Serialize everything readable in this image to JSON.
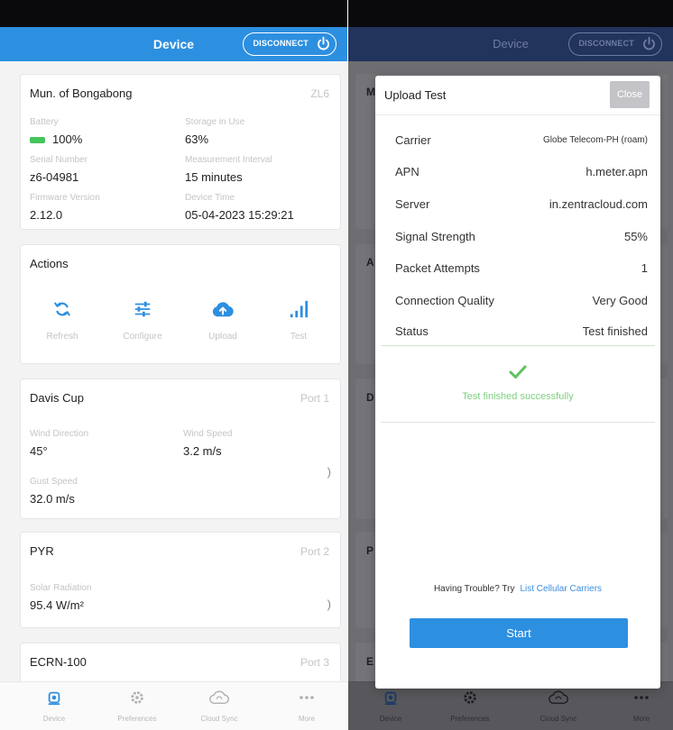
{
  "app": {
    "header_title": "Device",
    "disconnect_label": "DISCONNECT",
    "accent_color": "#2d8fe0"
  },
  "device": {
    "name": "Mun. of Bongabong",
    "model": "ZL6",
    "fields": [
      {
        "label": "Battery",
        "value": "100%"
      },
      {
        "label": "Storage in Use",
        "value": "63%"
      },
      {
        "label": "Serial Number",
        "value": "z6-04981"
      },
      {
        "label": "Measurement Interval",
        "value": "15 minutes"
      },
      {
        "label": "Firmware Version",
        "value": "2.12.0"
      },
      {
        "label": "Device Time",
        "value": "05-04-2023 15:29:21"
      }
    ]
  },
  "actions": {
    "title": "Actions",
    "items": [
      {
        "label": "Refresh",
        "icon": "refresh-icon"
      },
      {
        "label": "Configure",
        "icon": "sliders-icon"
      },
      {
        "label": "Upload",
        "icon": "cloud-upload-icon"
      },
      {
        "label": "Test",
        "icon": "signal-bars-icon"
      }
    ]
  },
  "sensors": [
    {
      "name": "Davis Cup",
      "port": "Port 1",
      "fields": [
        {
          "label": "Wind Direction",
          "value": "45°"
        },
        {
          "label": "Wind Speed",
          "value": "3.2 m/s"
        },
        {
          "label": "Gust Speed",
          "value": "32.0 m/s"
        }
      ]
    },
    {
      "name": "PYR",
      "port": "Port 2",
      "fields": [
        {
          "label": "Solar Radiation",
          "value": "95.4 W/m²"
        }
      ]
    },
    {
      "name": "ECRN-100",
      "port": "Port 3",
      "fields": []
    }
  ],
  "tabs": [
    {
      "label": "Device",
      "icon": "device-icon"
    },
    {
      "label": "Preferences",
      "icon": "gear-icon"
    },
    {
      "label": "Cloud Sync",
      "icon": "cloud-sync-icon"
    },
    {
      "label": "More",
      "icon": "more-icon"
    }
  ],
  "background": {
    "card_letters": [
      "M",
      "A",
      "D",
      "P",
      "E"
    ]
  },
  "upload_test": {
    "title": "Upload Test",
    "close_label": "Close",
    "rows": [
      {
        "label": "Carrier",
        "value": "Globe Telecom-PH (roam)"
      },
      {
        "label": "APN",
        "value": "h.meter.apn"
      },
      {
        "label": "Server",
        "value": "in.zentracloud.com"
      },
      {
        "label": "Signal Strength",
        "value": "55%"
      },
      {
        "label": "Packet Attempts",
        "value": "1"
      },
      {
        "label": "Connection Quality",
        "value": "Very Good"
      },
      {
        "label": "Status",
        "value": "Test finished"
      }
    ],
    "success_message": "Test finished successfully",
    "trouble_prompt": "Having Trouble? Try",
    "trouble_link": "List Cellular Carriers",
    "start_label": "Start",
    "success_color": "#7fd07f"
  }
}
